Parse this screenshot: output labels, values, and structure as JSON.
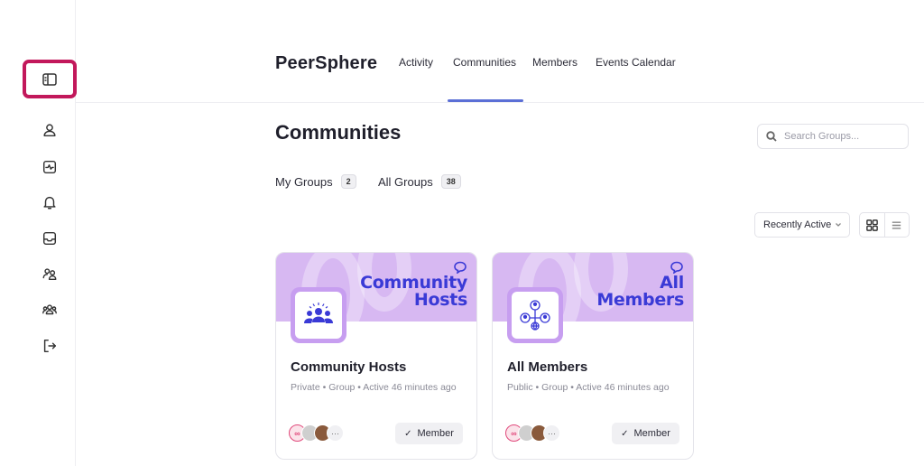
{
  "app": {
    "brand": "PeerSphere"
  },
  "nav": {
    "items": [
      {
        "label": "Activity"
      },
      {
        "label": "Communities"
      },
      {
        "label": "Members"
      },
      {
        "label": "Events Calendar"
      }
    ],
    "active": "Communities"
  },
  "sidebar": {
    "icons": [
      "sidebar-toggle-icon",
      "user-icon",
      "activity-icon",
      "bell-icon",
      "inbox-icon",
      "members-icon",
      "groups-icon",
      "logout-icon"
    ]
  },
  "page": {
    "title": "Communities",
    "search_placeholder": "Search Groups..."
  },
  "tabs": [
    {
      "label": "My Groups",
      "count": "2"
    },
    {
      "label": "All Groups",
      "count": "38"
    }
  ],
  "sort": {
    "selected": "Recently Active"
  },
  "cards": [
    {
      "banner_line1": "Community",
      "banner_line2": "Hosts",
      "name": "Community Hosts",
      "meta": "Private  •  Group  •  Active 46 minutes ago",
      "button": "Member"
    },
    {
      "banner_line1": "All",
      "banner_line2": "Members",
      "name": "All Members",
      "meta": "Public  •  Group  •  Active 46 minutes ago",
      "button": "Member"
    }
  ],
  "colors": {
    "accent": "#5b6fd6",
    "highlight": "#c2185b",
    "banner": "#d7b8f2",
    "banner_text": "#3a3ad6"
  }
}
